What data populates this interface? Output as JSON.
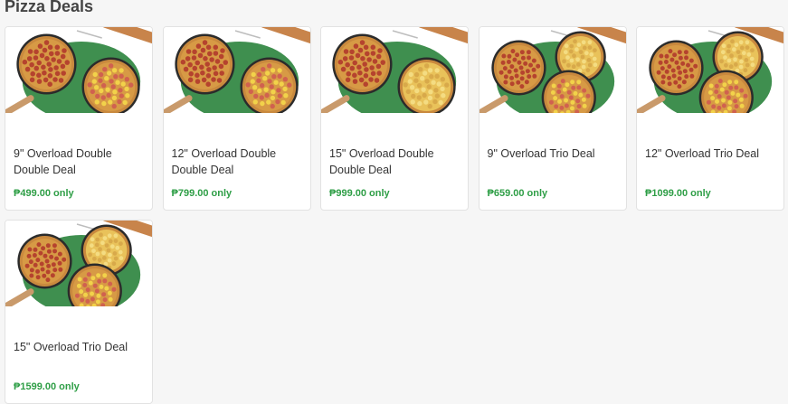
{
  "section": {
    "title": "Pizza Deals"
  },
  "colors": {
    "background": "#f6f6f6",
    "card_border": "#e2e2e2",
    "price_green": "#2e9e46",
    "mat_green": "#3f8f4f",
    "board_wood": "#c8844b"
  },
  "deals": [
    {
      "name": "9\" Overload Double Double Deal",
      "price": "₱499.00 only",
      "pizzas": 2
    },
    {
      "name": "12\" Overload Double Double Deal",
      "price": "₱799.00 only",
      "pizzas": 2
    },
    {
      "name": "15\" Overload Double Double Deal",
      "price": "₱999.00 only",
      "pizzas": 2
    },
    {
      "name": "9\" Overload Trio Deal",
      "price": "₱659.00 only",
      "pizzas": 3
    },
    {
      "name": "12\" Overload Trio Deal",
      "price": "₱1099.00 only",
      "pizzas": 3
    },
    {
      "name": "15\" Overload Trio Deal",
      "price": "₱1599.00 only",
      "pizzas": 3
    }
  ]
}
